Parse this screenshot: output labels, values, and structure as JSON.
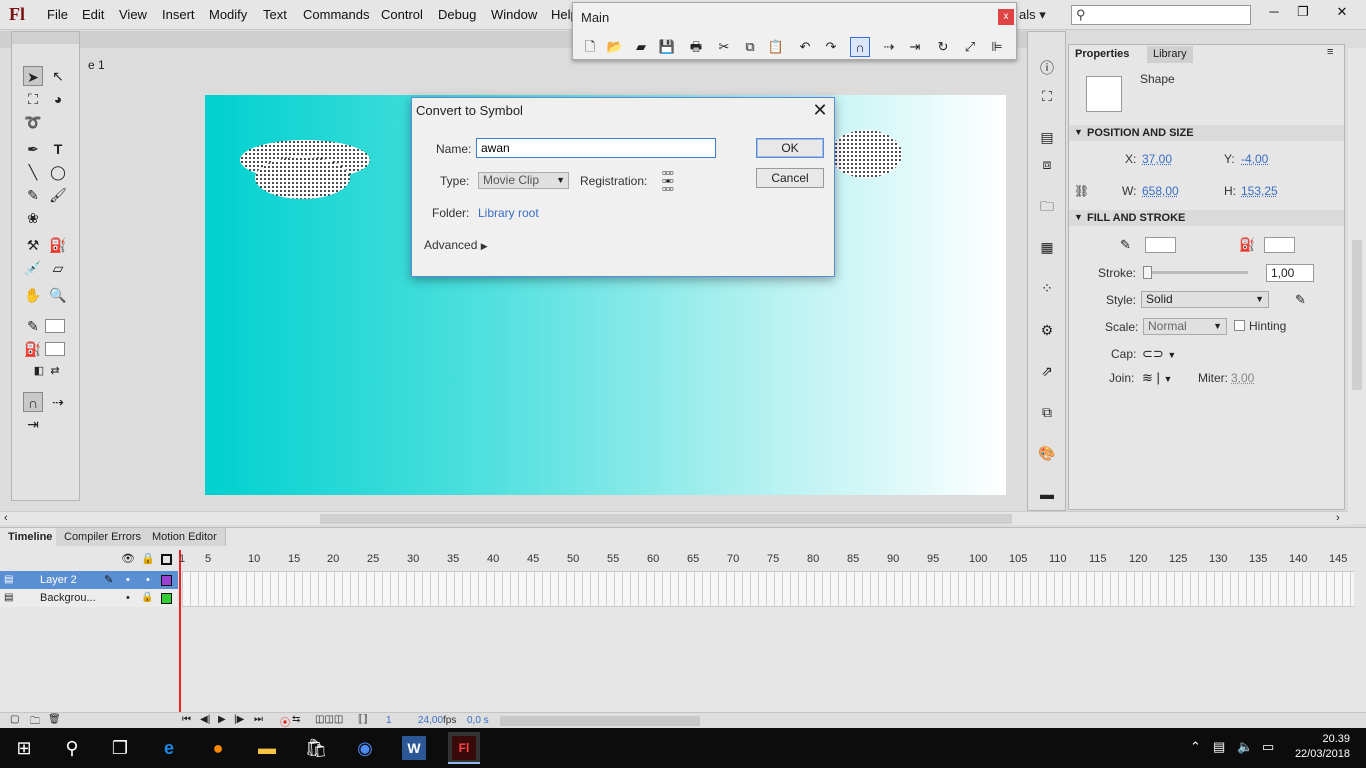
{
  "app": {
    "logo": "Fl"
  },
  "menu": [
    "File",
    "Edit",
    "View",
    "Insert",
    "Modify",
    "Text",
    "Commands",
    "Control",
    "Debug",
    "Window",
    "Help"
  ],
  "workspace_label": "als",
  "main_toolbar": {
    "title": "Main",
    "close": "x"
  },
  "document": {
    "scene_label": "e 1"
  },
  "properties": {
    "tab_properties": "Properties",
    "tab_library": "Library",
    "object_type": "Shape",
    "position_size_header": "POSITION AND SIZE",
    "x_label": "X:",
    "x_value": "37,00",
    "y_label": "Y:",
    "y_value": "-4,00",
    "w_label": "W:",
    "w_value": "658,00",
    "h_label": "H:",
    "h_value": "153,25",
    "fill_stroke_header": "FILL AND STROKE",
    "stroke_label": "Stroke:",
    "stroke_value": "1,00",
    "style_label": "Style:",
    "style_value": "Solid",
    "scale_label": "Scale:",
    "scale_value": "Normal",
    "hinting_label": "Hinting",
    "cap_label": "Cap:",
    "join_label": "Join:",
    "miter_label": "Miter:",
    "miter_value": "3,00"
  },
  "dialog": {
    "title": "Convert to Symbol",
    "name_label": "Name:",
    "name_value": "awan",
    "type_label": "Type:",
    "type_value": "Movie Clip",
    "registration_label": "Registration:",
    "folder_label": "Folder:",
    "folder_value": "Library root",
    "advanced_label": "Advanced",
    "ok": "OK",
    "cancel": "Cancel"
  },
  "timeline": {
    "tabs": [
      "Timeline",
      "Compiler Errors",
      "Motion Editor"
    ],
    "frame_numbers": [
      "1",
      "5",
      "10",
      "15",
      "20",
      "25",
      "30",
      "35",
      "40",
      "45",
      "50",
      "55",
      "60",
      "65",
      "70",
      "75",
      "80",
      "85",
      "90",
      "95",
      "100",
      "105",
      "110",
      "115",
      "120",
      "125",
      "130",
      "135",
      "140",
      "145"
    ],
    "layers": [
      {
        "name": "Layer 2",
        "color": "#9b3fd3"
      },
      {
        "name": "Backgrou...",
        "color": "#33cc33"
      }
    ],
    "current_frame": "1",
    "fps": "24,00",
    "fps_unit": "fps",
    "time": "0,0 s"
  },
  "taskbar": {
    "time": "20.39",
    "date": "22/03/2018"
  }
}
